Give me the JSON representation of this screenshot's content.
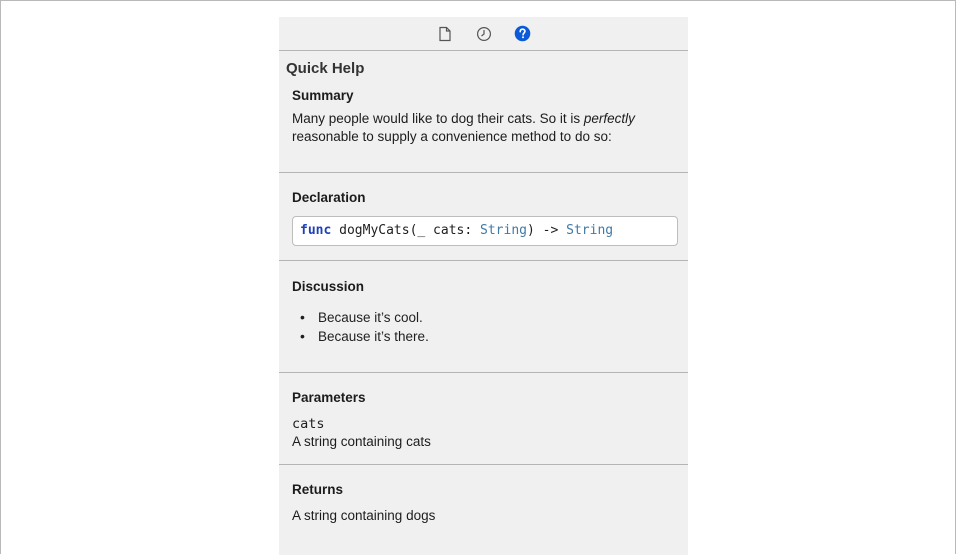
{
  "toolbar": {
    "icons": [
      "file-inspector-icon",
      "history-inspector-icon",
      "quick-help-icon"
    ],
    "active_color": "#0b5ad9"
  },
  "panel": {
    "title": "Quick Help"
  },
  "summary": {
    "heading": "Summary",
    "text_before": "Many people would like to dog their cats. So it is ",
    "emphasis": "perfectly",
    "text_after": " reasonable to supply a convenience method to do so:"
  },
  "declaration": {
    "heading": "Declaration",
    "keyword": "func",
    "name_part": " dogMyCats(_ cats: ",
    "param_type": "String",
    "arrow": ") -> ",
    "return_type": "String"
  },
  "discussion": {
    "heading": "Discussion",
    "bullets": [
      "Because it’s cool.",
      "Because it’s there."
    ]
  },
  "parameters": {
    "heading": "Parameters",
    "name": "cats",
    "description": "A string containing cats"
  },
  "returns": {
    "heading": "Returns",
    "description": "A string containing dogs"
  }
}
